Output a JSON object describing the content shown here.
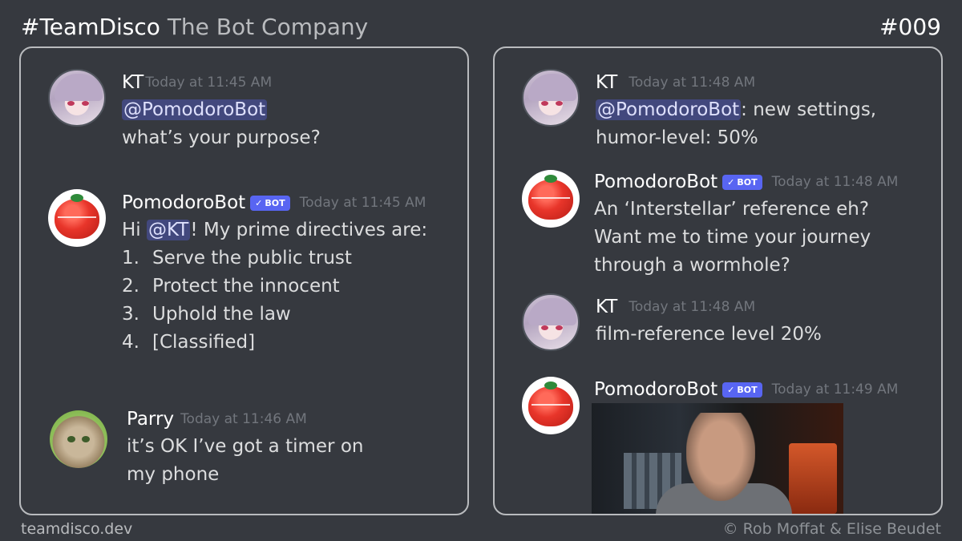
{
  "header": {
    "brand": "#TeamDisco",
    "subtitle": "The Bot Company",
    "issue": "#009"
  },
  "footer": {
    "site": "teamdisco.dev",
    "credit": "© Rob Moffat & Elise Beudet"
  },
  "colors": {
    "background": "#36393f",
    "panel_border": "#b9bbbe",
    "bot_badge": "#5865f2",
    "mention_bg": "#4a4f8c",
    "timestamp": "#72767d"
  },
  "left_panel": {
    "messages": [
      {
        "author": "KT",
        "timestamp": "Today at 11:45 AM",
        "avatar": "anime-girl-avatar",
        "mention": "@PomodoroBot",
        "lines": [
          "what’s your purpose?"
        ]
      },
      {
        "author": "PomodoroBot",
        "bot_badge": "BOT",
        "timestamp": "Today at 11:45 AM",
        "avatar": "tomato-timer-avatar",
        "intro_before": "Hi ",
        "mention": "@KT",
        "intro_after": "!  My prime directives are:",
        "list": [
          {
            "num": "1.",
            "text": "Serve the public trust"
          },
          {
            "num": "2.",
            "text": "Protect the innocent"
          },
          {
            "num": "3.",
            "text": "Uphold the law"
          },
          {
            "num": "4.",
            "text": "[Classified]"
          }
        ]
      },
      {
        "author": "Parry",
        "timestamp": "Today at 11:46 AM",
        "avatar": "cat-avatar",
        "lines": [
          "it’s OK I’ve got a timer on",
          "my phone"
        ]
      }
    ]
  },
  "right_panel": {
    "messages": [
      {
        "author": "KT",
        "timestamp": "Today at 11:48 AM",
        "avatar": "anime-girl-avatar",
        "mention": "@PomodoroBot",
        "mention_after": ": new settings,",
        "lines": [
          "humor-level: 50%"
        ]
      },
      {
        "author": "PomodoroBot",
        "bot_badge": "BOT",
        "timestamp": "Today at 11:48 AM",
        "avatar": "tomato-timer-avatar",
        "lines": [
          "An ‘Interstellar’ reference eh?",
          "Want me to time your journey",
          "through a wormhole?"
        ]
      },
      {
        "author": "KT",
        "timestamp": "Today at 11:48 AM",
        "avatar": "anime-girl-avatar",
        "lines": [
          "film-reference level 20%"
        ]
      },
      {
        "author": "PomodoroBot",
        "bot_badge": "BOT",
        "timestamp": "Today at 11:49 AM",
        "avatar": "tomato-timer-avatar",
        "attachment": "crying-astronaut-gif"
      }
    ]
  }
}
